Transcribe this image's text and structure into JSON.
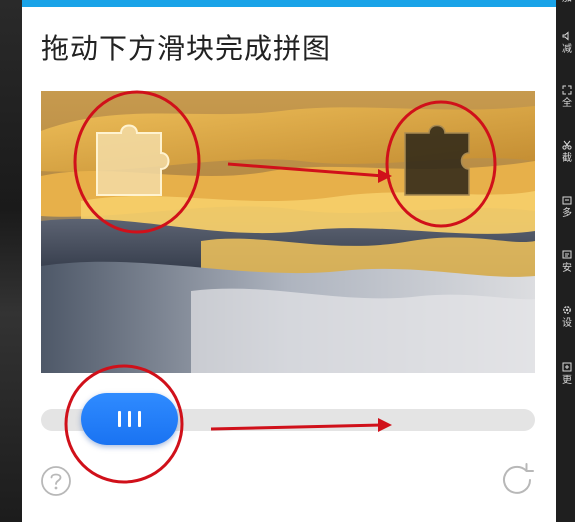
{
  "captcha": {
    "title": "拖动下方滑块完成拼图",
    "accent_color": "#1aa3e8",
    "handle_color": "#1a73f2",
    "help_icon": "question-circle-icon",
    "refresh_icon": "refresh-icon",
    "handle_icon": "grip-lines-icon"
  },
  "side_panel": {
    "items": [
      {
        "icon": "partial-icon",
        "label": "加"
      },
      {
        "icon": "speaker-icon",
        "label": "减"
      },
      {
        "icon": "fullscreen-icon",
        "label": "全"
      },
      {
        "icon": "scissors-icon",
        "label": "截"
      },
      {
        "icon": "window-icon",
        "label": "多"
      },
      {
        "icon": "screen-icon",
        "label": "安"
      },
      {
        "icon": "gear-icon",
        "label": "设"
      },
      {
        "icon": "more-icon",
        "label": "更"
      }
    ]
  },
  "annotation": {
    "color": "#d0101a"
  }
}
